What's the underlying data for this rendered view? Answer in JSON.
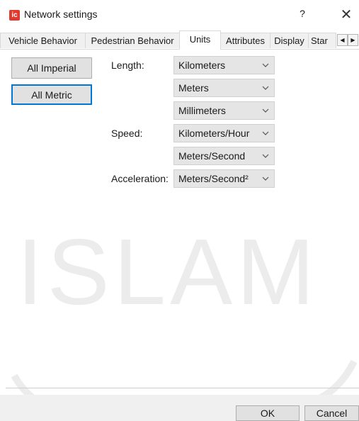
{
  "window": {
    "title": "Network settings",
    "icon_text": "ic",
    "help_label": "?",
    "close_label": "✕",
    "accent_color": "#0078d7",
    "icon_color": "#e03a2f"
  },
  "tabs": [
    {
      "label": "Vehicle Behavior",
      "active": false
    },
    {
      "label": "Pedestrian Behavior",
      "active": false
    },
    {
      "label": "Units",
      "active": true
    },
    {
      "label": "Attributes",
      "active": false
    },
    {
      "label": "Display",
      "active": false
    },
    {
      "label": "Star",
      "active": false
    }
  ],
  "tab_scroll": {
    "left": "◀",
    "right": "▶"
  },
  "buttons": {
    "all_imperial": "All Imperial",
    "all_metric": "All Metric",
    "ok": "OK",
    "cancel": "Cancel"
  },
  "labels": {
    "length": "Length:",
    "speed": "Speed:",
    "acceleration": "Acceleration:"
  },
  "combos": {
    "length_1": "Kilometers",
    "length_2": "Meters",
    "length_3": "Millimeters",
    "speed_1": "Kilometers/Hour",
    "speed_2": "Meters/Second",
    "acceleration_1": "Meters/Second²"
  },
  "watermark": "ISLAM"
}
